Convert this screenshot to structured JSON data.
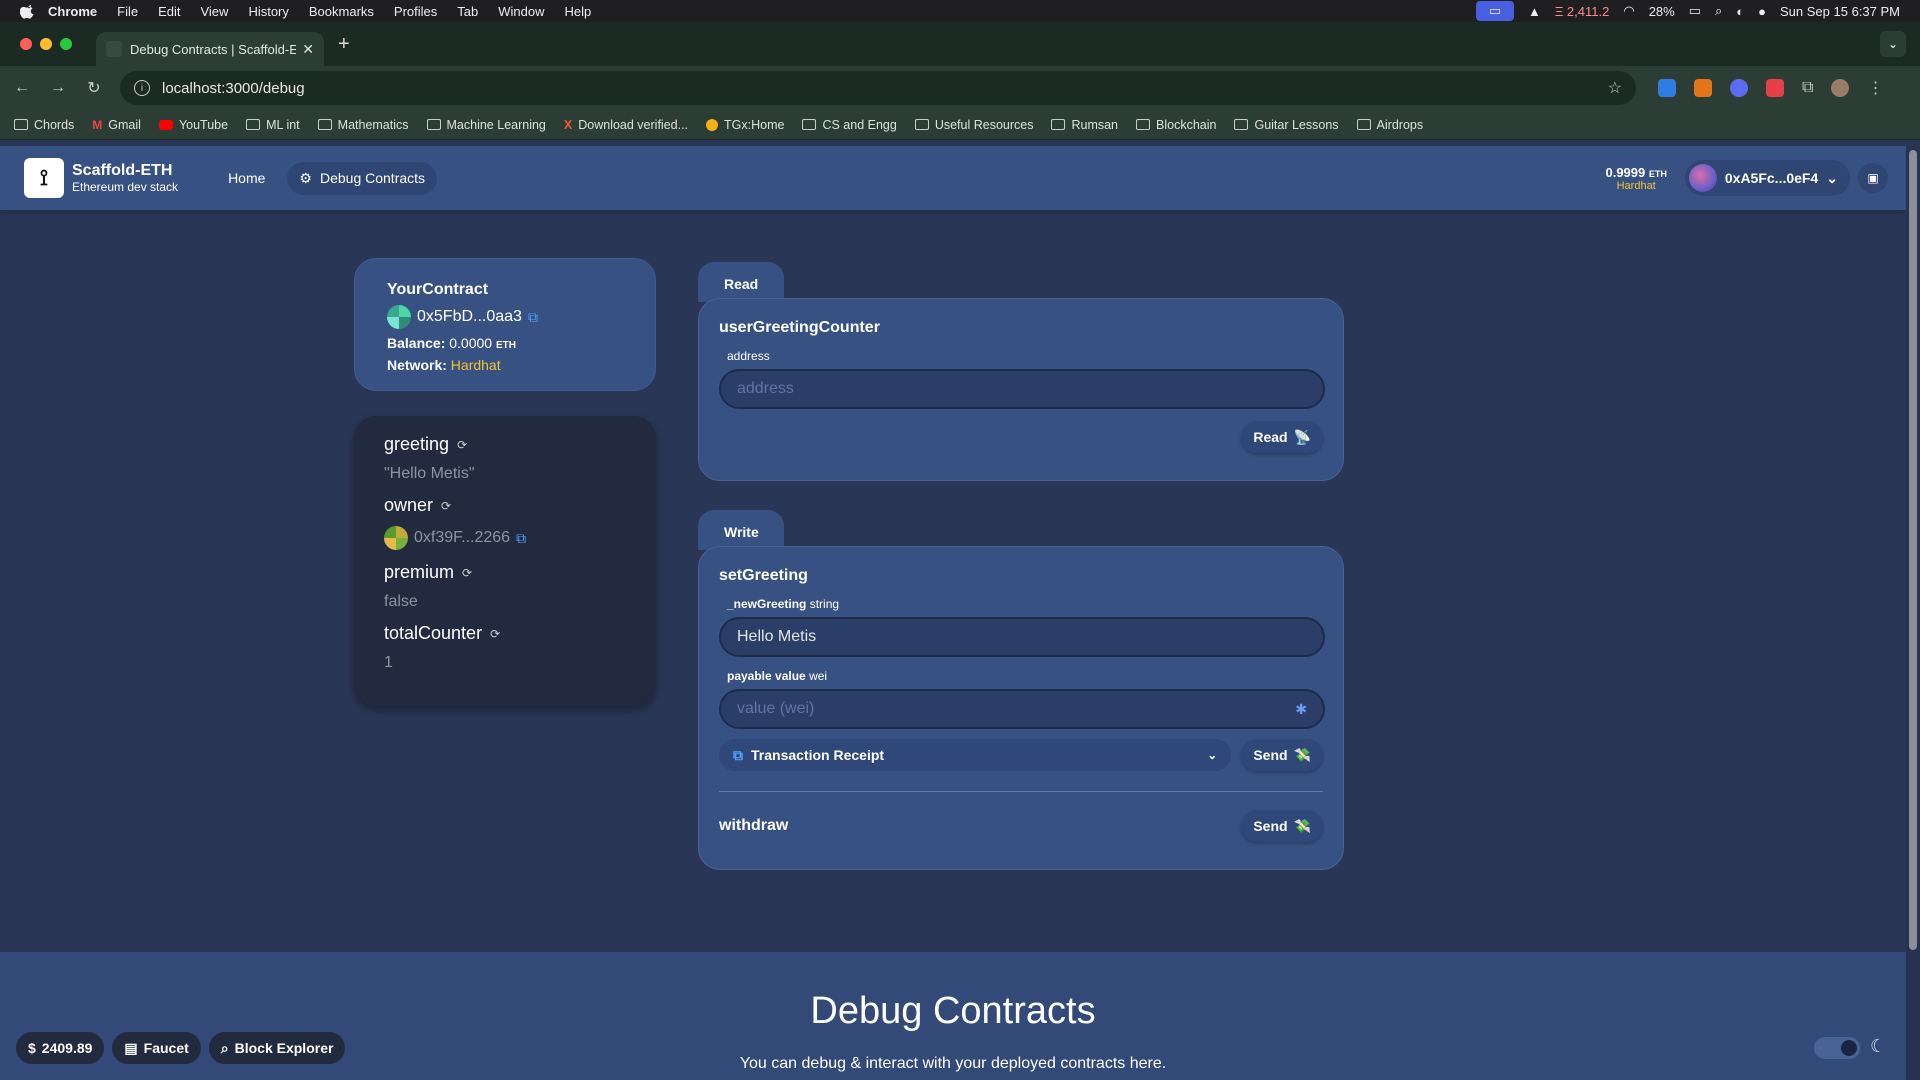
{
  "menubar": {
    "items": [
      "Chrome",
      "File",
      "Edit",
      "View",
      "History",
      "Bookmarks",
      "Profiles",
      "Tab",
      "Window",
      "Help"
    ],
    "price": "Ξ 2,411.2",
    "battery": "28%",
    "datetime": "Sun Sep 15  6:37 PM"
  },
  "browser": {
    "tab_title": "Debug Contracts | Scaffold-E",
    "url": "localhost:3000/debug",
    "bookmarks": [
      "Chords",
      "Gmail",
      "YouTube",
      "ML int",
      "Mathematics",
      "Machine Learning",
      "Download verified...",
      "TGx:Home",
      "CS and Engg",
      "Useful Resources",
      "Rumsan",
      "Blockchain",
      "Guitar Lessons",
      "Airdrops"
    ]
  },
  "header": {
    "brand_title": "Scaffold-ETH",
    "brand_subtitle": "Ethereum dev stack",
    "nav_home": "Home",
    "nav_debug": "Debug Contracts",
    "balance_value": "0.9999",
    "balance_unit": "ETH",
    "network": "Hardhat",
    "account": "0xA5Fc...0eF4"
  },
  "contract": {
    "name": "YourContract",
    "address": "0x5FbD...0aa3",
    "balance_label": "Balance:",
    "balance_value": "0.0000",
    "balance_unit": "ETH",
    "network_label": "Network:",
    "network": "Hardhat"
  },
  "vars": [
    {
      "name": "greeting",
      "value": "\"Hello Metis\""
    },
    {
      "name": "owner",
      "value": "0xf39F...2266"
    },
    {
      "name": "premium",
      "value": "false"
    },
    {
      "name": "totalCounter",
      "value": "1"
    }
  ],
  "read": {
    "tab": "Read",
    "fn": "userGreetingCounter",
    "param": "address",
    "placeholder": "address",
    "button": "Read"
  },
  "write": {
    "tab": "Write",
    "fn": "setGreeting",
    "param_name": "_newGreeting",
    "param_type": "string",
    "param_value": "Hello Metis",
    "payable_label": "payable value",
    "payable_unit": "wei",
    "payable_placeholder": "value (wei)",
    "receipt": "Transaction Receipt",
    "send": "Send",
    "fn2": "withdraw",
    "send2": "Send"
  },
  "footer": {
    "title": "Debug Contracts",
    "subtitle": "You can debug & interact with your deployed contracts here.",
    "price_chip": "2409.89",
    "faucet": "Faucet",
    "explorer": "Block Explorer"
  }
}
